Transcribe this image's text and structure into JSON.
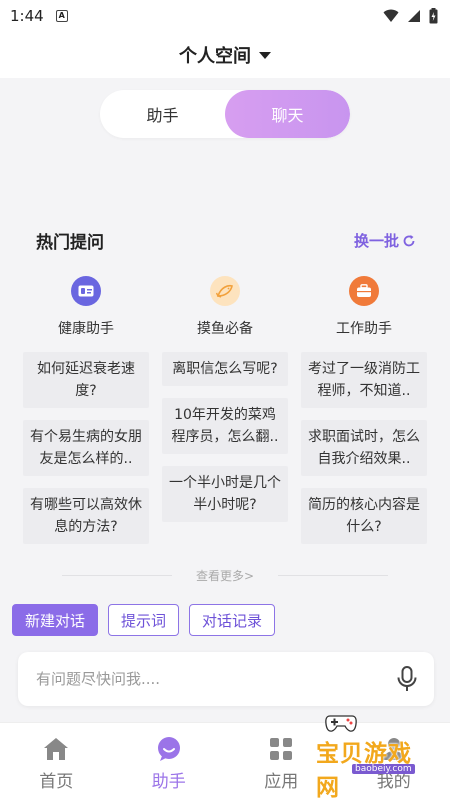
{
  "status_bar": {
    "time": "1:44",
    "notification_letter": "A"
  },
  "header": {
    "title": "个人空间"
  },
  "segments": {
    "items": [
      "助手",
      "聊天"
    ],
    "active_index": 1
  },
  "hot": {
    "title": "热门提问",
    "refresh_label": "换一批",
    "columns": [
      {
        "name": "健康助手",
        "icon": "id-card-icon",
        "icon_color": "#6a66e0",
        "icon_bg": "#6a66e0",
        "questions": [
          "如何延迟衰老速度?",
          "有个易生病的女朋友是怎么样的..",
          "有哪些可以高效休息的方法?"
        ]
      },
      {
        "name": "摸鱼必备",
        "icon": "fish-icon",
        "icon_color": "#f2a13c",
        "icon_bg": "#fde3be",
        "questions": [
          "离职信怎么写呢?",
          "10年开发的菜鸡程序员，怎么翻..",
          "一个半小时是几个半小时呢?"
        ]
      },
      {
        "name": "工作助手",
        "icon": "briefcase-icon",
        "icon_color": "#f07a3a",
        "icon_bg": "#f07a3a",
        "questions": [
          "考过了一级消防工程师，不知道..",
          "求职面试时，怎么自我介绍效果..",
          "简历的核心内容是什么?"
        ]
      }
    ],
    "more_label": "查看更多>"
  },
  "chips": [
    "新建对话",
    "提示词",
    "对话记录"
  ],
  "input": {
    "placeholder": "有问题尽快问我...."
  },
  "tabbar": {
    "items": [
      {
        "label": "首页",
        "icon": "home-icon"
      },
      {
        "label": "助手",
        "icon": "chat-bubble-icon"
      },
      {
        "label": "应用",
        "icon": "apps-icon"
      },
      {
        "label": "我的",
        "icon": "user-icon"
      }
    ],
    "active_index": 1
  },
  "watermark": {
    "text": "宝贝游戏网",
    "url": "baobeiy.com"
  },
  "colors": {
    "accent": "#8b6ce8",
    "segment_active": "#d49cf0",
    "refresh": "#7f62e0"
  }
}
